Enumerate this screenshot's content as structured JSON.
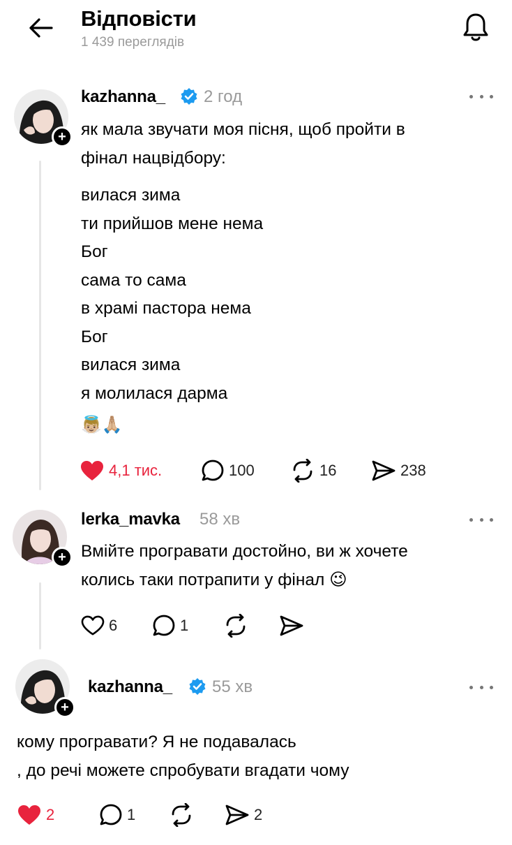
{
  "header": {
    "title": "Відповісти",
    "views": "1 439 переглядів"
  },
  "colors": {
    "like_red": "#e8233d",
    "verified_blue": "#1d9bf0",
    "muted": "#9a9a9a"
  },
  "posts": [
    {
      "username": "kazhanna_",
      "verified": true,
      "time": "2 год",
      "intro": [
        "як мала звучати моя пісня, щоб пройти в",
        "фінал нацвідбору:"
      ],
      "lines": [
        "вилася зима",
        "ти прийшов мене нема",
        "Бог",
        "сама то сама",
        "в храмі пастора нема",
        "Бог",
        "вилася зима",
        "я молилася дарма"
      ],
      "emoji": "👼🏼🙏🏼",
      "likes": "4,1 тис.",
      "replies": "100",
      "reposts": "16",
      "shares": "238",
      "liked": true
    },
    {
      "username": "lerka_mavka",
      "verified": false,
      "time": "58 хв",
      "text": [
        "Вмійте програвати достойно, ви ж хочете",
        "колись таки потрапити у фінал 😉"
      ],
      "likes": "6",
      "replies": "1",
      "reposts": "",
      "shares": "",
      "liked": false
    },
    {
      "username": "kazhanna_",
      "verified": true,
      "time": "55 хв",
      "text": [
        "кому програвати? Я не подавалась",
        ", до речі можете спробувати вгадати чому"
      ],
      "likes": "2",
      "replies": "1",
      "reposts": "",
      "shares": "2",
      "liked": true
    }
  ]
}
